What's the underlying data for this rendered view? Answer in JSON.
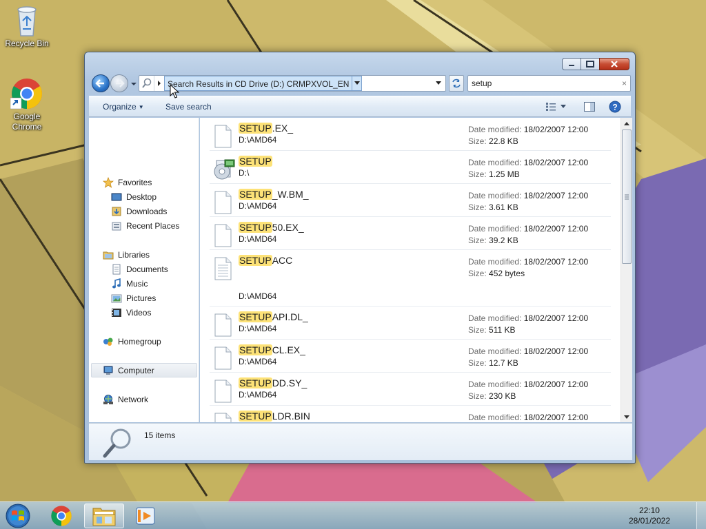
{
  "desktop": {
    "icons": [
      {
        "label": "Recycle Bin"
      },
      {
        "label": "Google Chrome"
      }
    ]
  },
  "window": {
    "address": {
      "breadcrumb": "Search Results in CD Drive (D:) CRMPXVOL_EN"
    },
    "search": {
      "value": "setup",
      "clear_glyph": "×"
    },
    "commandbar": {
      "organize": "Organize",
      "save_search": "Save search"
    },
    "navpane": {
      "favorites": "Favorites",
      "desktop": "Desktop",
      "downloads": "Downloads",
      "recent_places": "Recent Places",
      "libraries": "Libraries",
      "documents": "Documents",
      "music": "Music",
      "pictures": "Pictures",
      "videos": "Videos",
      "homegroup": "Homegroup",
      "computer": "Computer",
      "network": "Network"
    },
    "labels": {
      "date_modified": "Date modified:",
      "size": "Size:"
    },
    "results": [
      {
        "match": "SETUP",
        "rest": ".EX_",
        "path": "D:\\AMD64",
        "date": "18/02/2007 12:00",
        "size": "22.8 KB",
        "icon": "blank-file-icon"
      },
      {
        "match": "SETUP",
        "rest": "",
        "path": "D:\\",
        "date": "18/02/2007 12:00",
        "size": "1.25 MB",
        "icon": "setup-installer-icon"
      },
      {
        "match": "SETUP",
        "rest": "_W.BM_",
        "path": "D:\\AMD64",
        "date": "18/02/2007 12:00",
        "size": "3.61 KB",
        "icon": "blank-file-icon"
      },
      {
        "match": "SETUP",
        "rest": "50.EX_",
        "path": "D:\\AMD64",
        "date": "18/02/2007 12:00",
        "size": "39.2 KB",
        "icon": "blank-file-icon"
      },
      {
        "match": "SETUP",
        "rest": "ACC",
        "path": "D:\\AMD64",
        "date": "18/02/2007 12:00",
        "size": "452 bytes",
        "icon": "text-file-icon"
      },
      {
        "match": "SETUP",
        "rest": "API.DL_",
        "path": "D:\\AMD64",
        "date": "18/02/2007 12:00",
        "size": "511 KB",
        "icon": "blank-file-icon"
      },
      {
        "match": "SETUP",
        "rest": "CL.EX_",
        "path": "D:\\AMD64",
        "date": "18/02/2007 12:00",
        "size": "12.7 KB",
        "icon": "blank-file-icon"
      },
      {
        "match": "SETUP",
        "rest": "DD.SY_",
        "path": "D:\\AMD64",
        "date": "18/02/2007 12:00",
        "size": "230 KB",
        "icon": "blank-file-icon"
      },
      {
        "match": "SETUP",
        "rest": "LDR.BIN",
        "path": "",
        "date": "18/02/2007 12:00",
        "size": "",
        "icon": "blank-file-icon"
      }
    ],
    "details": {
      "count": "15 items"
    }
  },
  "taskbar": {
    "time": "22:10",
    "date": "28/01/2022"
  }
}
